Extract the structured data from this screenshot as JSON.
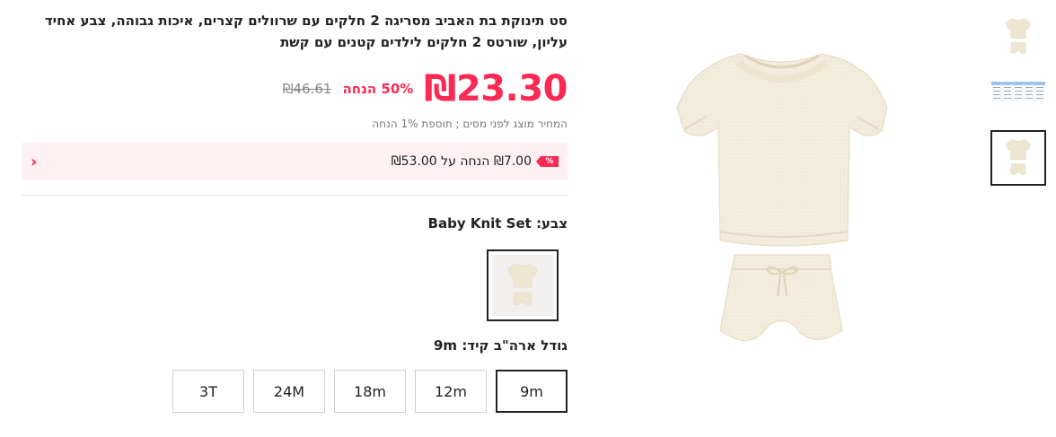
{
  "product": {
    "title": "סט תינוקת בת האביב מסריגה 2 חלקים עם שרוולים קצרים, איכות גבוהה, צבע אחיד עליון, שורטס 2 חלקים לילדים קטנים עם קשת",
    "price": "₪23.30",
    "discount_label": "50% הנחה",
    "original_price": "₪46.61",
    "tax_note": "המחיר מוצג לפני מסים ; תוספת 1% הנחה"
  },
  "promo": {
    "tag": "%",
    "text": "₪7.00 הנחה על ₪53.00",
    "chevron": "›"
  },
  "color": {
    "label": "צבע:",
    "value": "Baby Knit Set"
  },
  "size": {
    "label": "גודל ארה\"ב קיד:",
    "value": "9m",
    "options": [
      "9m",
      "12m",
      "18m",
      "24M",
      "3T"
    ],
    "selected_index": 0
  },
  "colors": {
    "accent": "#fa2a55",
    "promo_bg": "#fff0f3",
    "garment": "#f2ecdc"
  }
}
